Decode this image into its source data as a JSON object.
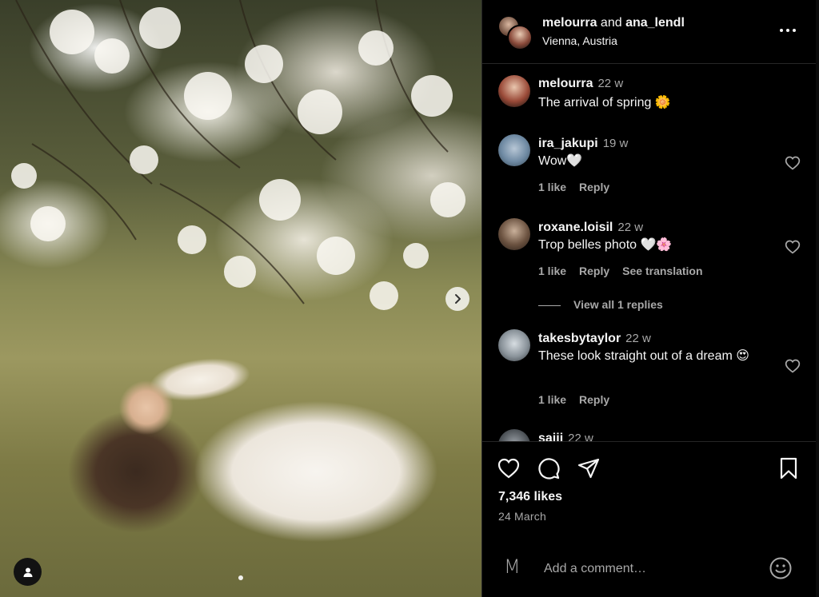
{
  "post": {
    "photo_alt": "",
    "slide_count": 2,
    "active_slide": 1
  },
  "header": {
    "user1": "melourra",
    "and_text": "and",
    "user2": "ana_lendl",
    "location": "Vienna, Austria"
  },
  "comments": [
    {
      "user": "melourra",
      "time": "22 w",
      "text": "The arrival of spring 🌼",
      "likes": "",
      "reply": "",
      "translate": ""
    },
    {
      "user": "ira_jakupi",
      "time": "19 w",
      "text": "Wow🤍",
      "likes": "1 like",
      "reply": "Reply",
      "translate": ""
    },
    {
      "user": "roxane.loisil",
      "time": "22 w",
      "text": "Trop belles photo 🤍🌸",
      "likes": "1 like",
      "reply": "Reply",
      "translate": "See translation",
      "view_replies": "View all 1 replies"
    },
    {
      "user": "takesbytaylor",
      "time": "22 w",
      "text": "These look straight out of a dream 😍",
      "likes": "1 like",
      "reply": "Reply",
      "translate": ""
    },
    {
      "user": "saiii",
      "time": "22 w",
      "text": "",
      "likes": "",
      "reply": "",
      "translate": ""
    }
  ],
  "actions": {
    "likes": "7,346 likes",
    "date": "24 March"
  },
  "comment_box": {
    "placeholder": "Add a comment…",
    "left_glyph": "M"
  },
  "icons": [
    "more-icon",
    "heart-icon",
    "comment-icon",
    "share-icon",
    "bookmark-icon",
    "emoji-icon",
    "chevron-right-icon",
    "user-tag-icon"
  ],
  "colors": {
    "background": "#000000",
    "text": "#f5f5f5",
    "secondary": "#a8a8a8",
    "divider": "#262626"
  }
}
